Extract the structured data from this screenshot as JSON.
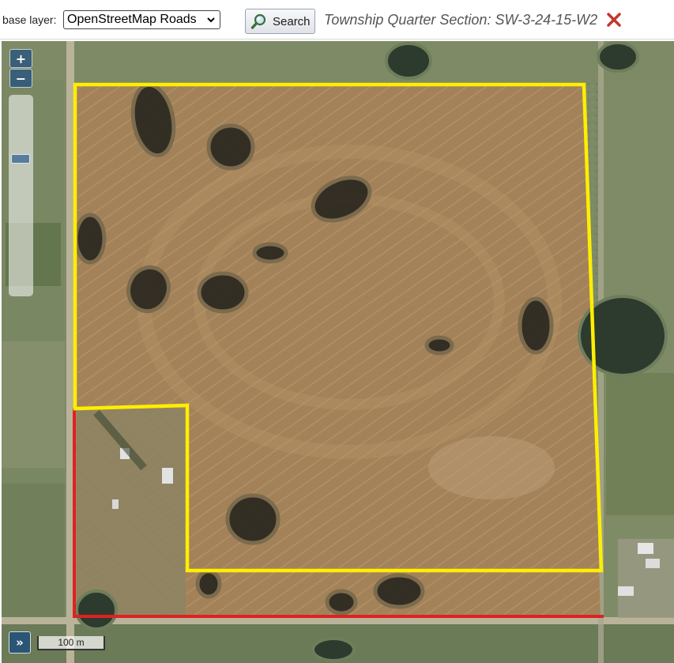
{
  "toolbar": {
    "base_layer_label": "base layer:",
    "base_layer_selected": "OpenStreetMap Roads",
    "search_label": "Search",
    "location_title": "Township Quarter Section: SW-3-24-15-W2"
  },
  "map": {
    "zoom_in_label": "+",
    "zoom_out_label": "−",
    "expand_label": "»",
    "scale_label": "100 m"
  },
  "icons": {
    "search": "magnifier-icon",
    "clear": "close-x-icon",
    "select": "chevron-down-icon"
  },
  "colors": {
    "quarter_section_outline": "#ffee00",
    "parcel_outline": "#dd2222",
    "clear_icon": "#c0392b",
    "zoom_control": "#003c88"
  }
}
